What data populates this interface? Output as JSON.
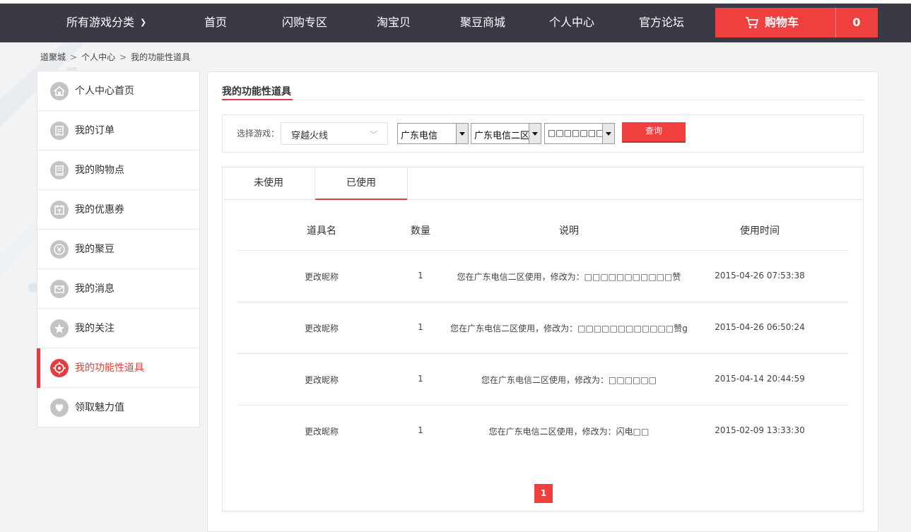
{
  "nav": {
    "categories_label": "所有游戏分类",
    "items": [
      "首页",
      "闪购专区",
      "淘宝贝",
      "聚豆商城",
      "个人中心",
      "官方论坛"
    ],
    "cart_label": "购物车",
    "cart_count": "0"
  },
  "breadcrumb": [
    "道聚城",
    "个人中心",
    "我的功能性道具"
  ],
  "sidebar": {
    "items": [
      {
        "label": "个人中心首页",
        "icon": "house-icon"
      },
      {
        "label": "我的订单",
        "icon": "notepad-icon"
      },
      {
        "label": "我的购物点",
        "icon": "ledger-icon"
      },
      {
        "label": "我的优惠券",
        "icon": "coupon-icon"
      },
      {
        "label": "我的聚豆",
        "icon": "yen-coin-icon"
      },
      {
        "label": "我的消息",
        "icon": "envelope-icon"
      },
      {
        "label": "我的关注",
        "icon": "star-icon"
      },
      {
        "label": "我的功能性道具",
        "icon": "target-icon",
        "active": true
      },
      {
        "label": "领取魅力值",
        "icon": "heart-icon"
      }
    ],
    "active_color": "#e33e3e"
  },
  "panel": {
    "title": "我的功能性道具",
    "filter": {
      "label": "选择游戏：",
      "game": "穿越火线",
      "region": "广东电信",
      "server": "广东电信二区",
      "role": "□□□□□□□□□□",
      "query_label": "查询"
    },
    "tabs": [
      "未使用",
      "已使用"
    ],
    "active_tab": 1,
    "table": {
      "headers": [
        "道具名",
        "数量",
        "说明",
        "使用时间"
      ],
      "rows": [
        [
          "更改昵称",
          "1",
          "您在广东电信二区使用，修改为：□□□□□□□□□□□赞",
          "2015-04-26 07:53:38"
        ],
        [
          "更改昵称",
          "1",
          "您在广东电信二区使用，修改为：□□□□□□□□□□□□赞g",
          "2015-04-26 06:50:24"
        ],
        [
          "更改昵称",
          "1",
          "您在广东电信二区使用，修改为：□□□□□□",
          "2015-04-14 20:44:59"
        ],
        [
          "更改昵称",
          "1",
          "您在广东电信二区使用，修改为：闪电□□",
          "2015-02-09 13:33:30"
        ]
      ]
    },
    "pagination": {
      "current": "1"
    }
  },
  "colors": {
    "topbar": "#3a3a45",
    "accent": "#ef3f3f"
  }
}
